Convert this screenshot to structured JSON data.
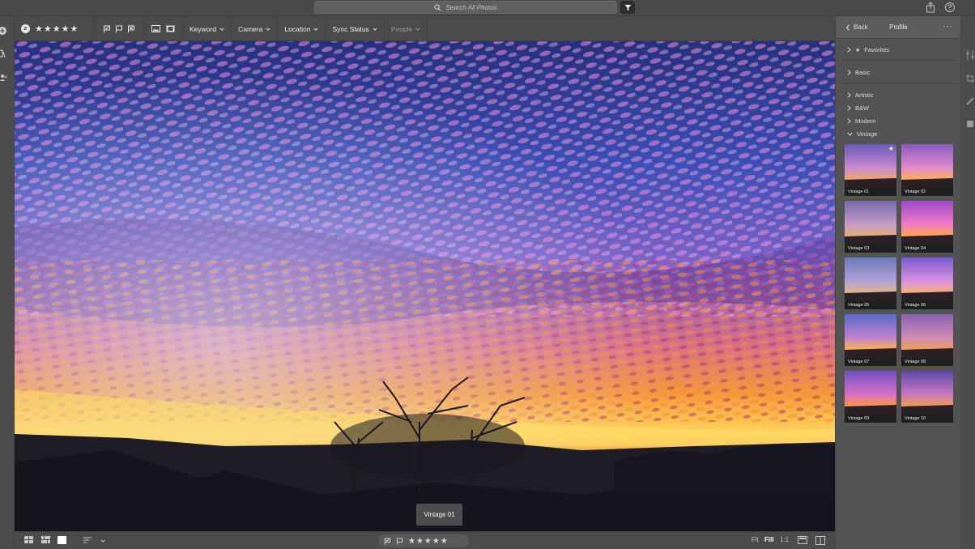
{
  "search": {
    "placeholder": "Search All Photos"
  },
  "filter_bar": {
    "rating_badge": "≥",
    "stars": "★★★★★",
    "dropdowns": [
      {
        "label": "Keyword"
      },
      {
        "label": "Camera"
      },
      {
        "label": "Location"
      },
      {
        "label": "Sync Status"
      },
      {
        "label": "People"
      }
    ]
  },
  "photo": {
    "profile_label": "Vintage 01"
  },
  "bottom_bar": {
    "stars": "★★★★★",
    "zoom": {
      "fit": "Fit",
      "fill": "Fill",
      "one_to_one": "1:1"
    }
  },
  "panel": {
    "back_label": "Back",
    "title": "Profile",
    "more": "···",
    "groups": [
      {
        "label": "Favorites",
        "star": "★"
      },
      {
        "label": "Basic"
      },
      {
        "label": "Artistic"
      },
      {
        "label": "B&W"
      },
      {
        "label": "Modern"
      },
      {
        "label": "Vintage"
      }
    ],
    "thumbnails": [
      {
        "label": "Vintage 01",
        "favorite": "★"
      },
      {
        "label": "Vintage 02"
      },
      {
        "label": "Vintage 03"
      },
      {
        "label": "Vintage 04"
      },
      {
        "label": "Vintage 05"
      },
      {
        "label": "Vintage 06"
      },
      {
        "label": "Vintage 07"
      },
      {
        "label": "Vintage 08"
      },
      {
        "label": "Vintage 09"
      },
      {
        "label": "Vintage 10"
      }
    ]
  },
  "colors": {
    "sky_top": "#2b3a8c",
    "cloud_magenta": "#c667c4",
    "sunset_orange": "#f3952e",
    "horizon_gold": "#ffd85a",
    "app_bg": "#535353"
  }
}
